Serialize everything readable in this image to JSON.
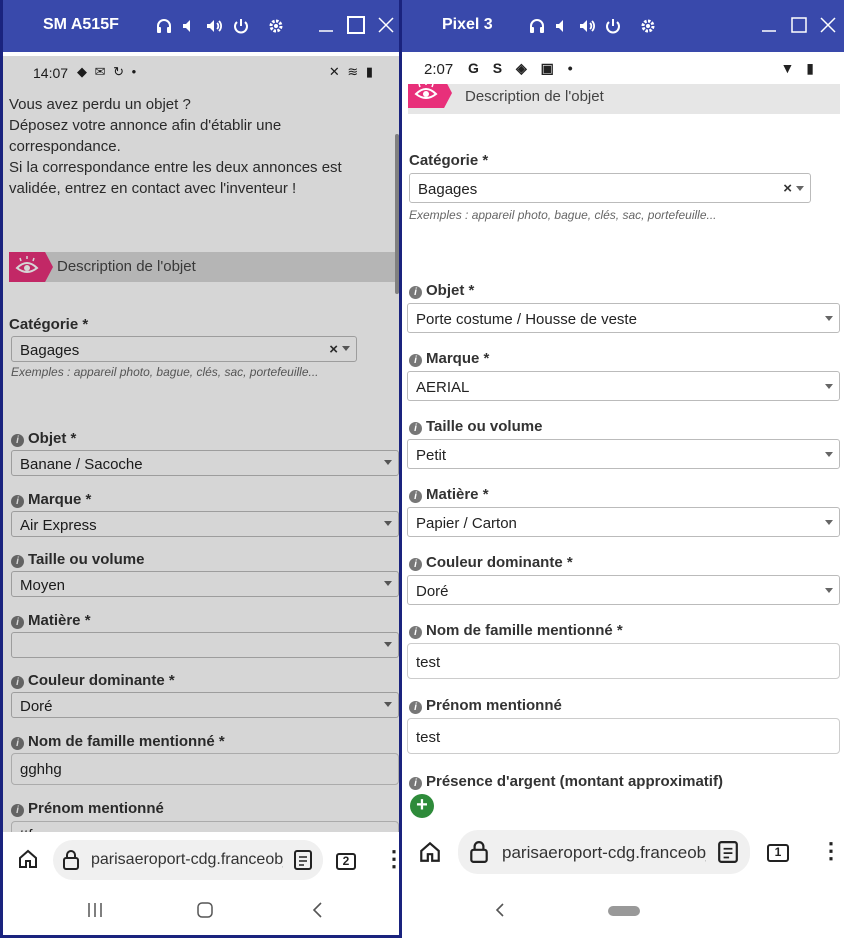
{
  "left": {
    "device_name": "SM A515F",
    "status_time": "14:07",
    "intro_lines": [
      "Vous avez perdu un objet ?",
      "Déposez votre annonce afin d'établir une",
      "correspondance.",
      "Si la correspondance entre les deux annonces est",
      "validée, entrez en contact avec l'inventeur !"
    ],
    "section_title": "Description de l'objet",
    "categorie_label": "Catégorie *",
    "categorie_value": "Bagages",
    "categorie_help": "Exemples : appareil photo, bague, clés, sac, portefeuille...",
    "objet_label": "Objet *",
    "objet_value": "Banane / Sacoche",
    "marque_label": "Marque *",
    "marque_value": "Air Express",
    "taille_label": "Taille ou volume",
    "taille_value": "Moyen",
    "matiere_label": "Matière *",
    "matiere_value": "",
    "couleur_label": "Couleur dominante *",
    "couleur_value": "Doré",
    "nom_label": "Nom de famille mentionné *",
    "nom_value": "gghhg",
    "prenom_label": "Prénom mentionné",
    "prenom_value": "ttfgg",
    "url": "parisaeroport-cdg.franceobj",
    "tab_count": "2"
  },
  "right": {
    "device_name": "Pixel 3",
    "status_time": "2:07",
    "section_title": "Description de l'objet",
    "categorie_label": "Catégorie *",
    "categorie_value": "Bagages",
    "categorie_help": "Exemples : appareil photo, bague, clés, sac, portefeuille...",
    "objet_label": "Objet *",
    "objet_value": "Porte costume / Housse de veste",
    "marque_label": "Marque *",
    "marque_value": "AERIAL",
    "taille_label": "Taille ou volume",
    "taille_value": "Petit",
    "matiere_label": "Matière *",
    "matiere_value": "Papier / Carton",
    "couleur_label": "Couleur dominante *",
    "couleur_value": "Doré",
    "nom_label": "Nom de famille mentionné *",
    "nom_value": "test",
    "prenom_label": "Prénom mentionné",
    "prenom_value": "test",
    "argent_label": "Présence d'argent (montant approximatif)",
    "add_symbol": "+",
    "url": "parisaeroport-cdg.franceobj",
    "tab_count": "1"
  },
  "colors": {
    "titlebar": "#3949ab",
    "accent_pink": "#e8307a",
    "add_green": "#2e8b3a"
  },
  "icons": [
    "headphones-icon",
    "volume-down-icon",
    "volume-up-icon",
    "power-icon",
    "settings-icon",
    "minimize-icon",
    "maximize-icon",
    "close-icon",
    "eye-icon",
    "info-icon",
    "home-icon",
    "lock-icon",
    "reader-mode-icon",
    "more-icon"
  ]
}
